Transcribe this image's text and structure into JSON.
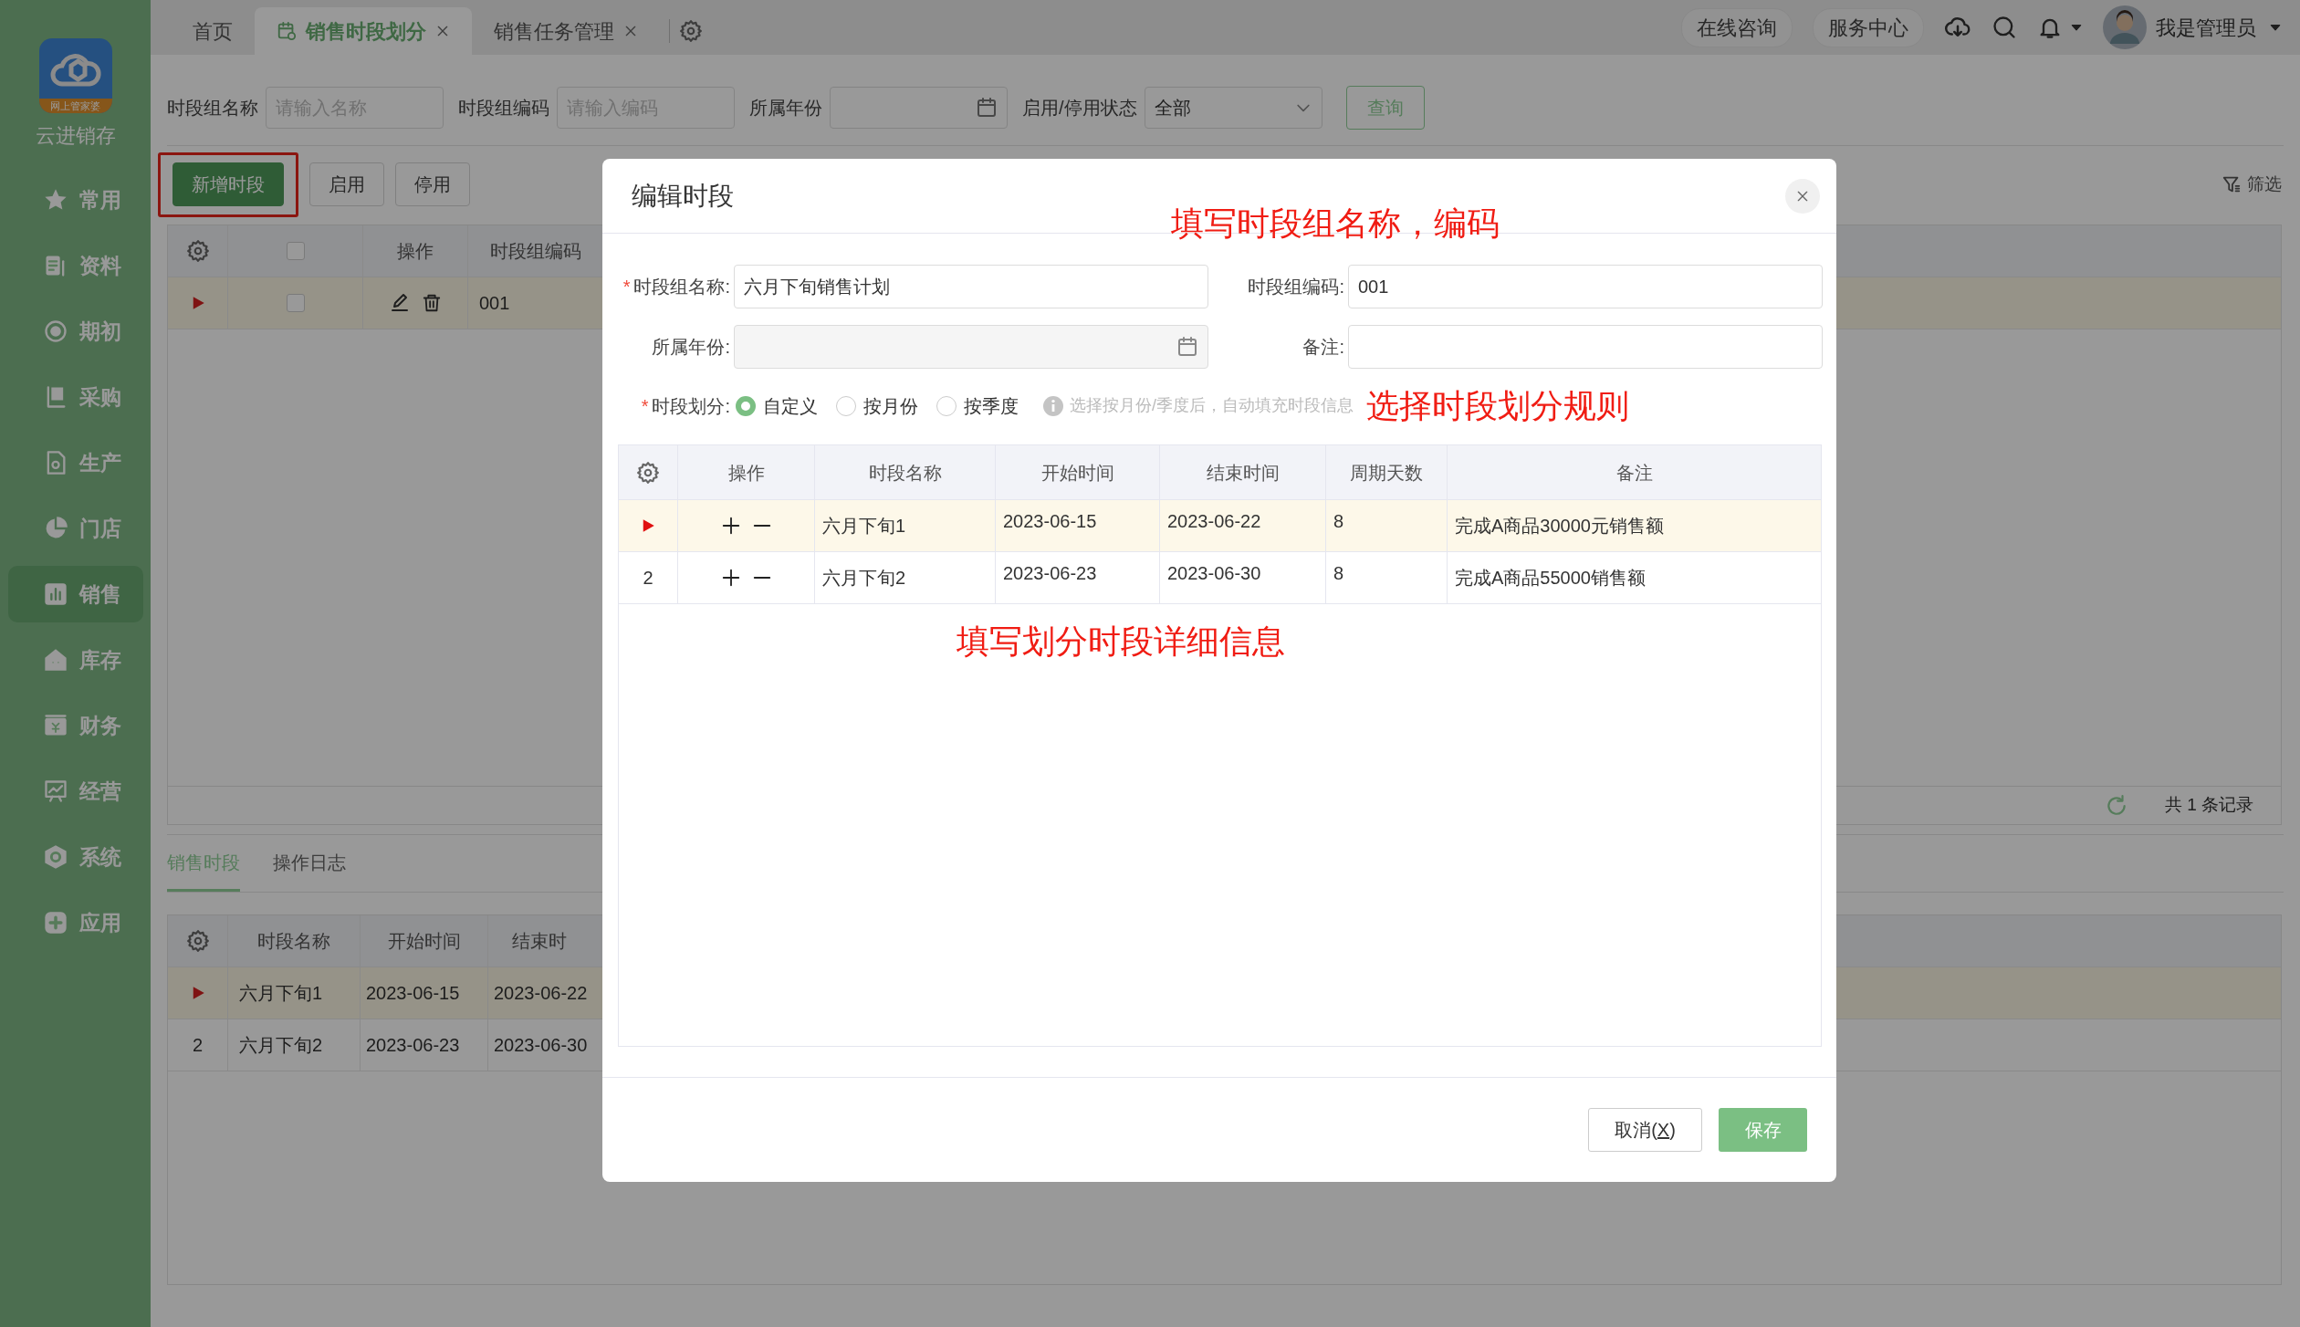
{
  "sidebar": {
    "logo_caption": "网上管家婆",
    "app_name": "云进销存",
    "items": [
      {
        "label": "常用",
        "selected": false
      },
      {
        "label": "资料",
        "selected": false
      },
      {
        "label": "期初",
        "selected": false
      },
      {
        "label": "采购",
        "selected": false
      },
      {
        "label": "生产",
        "selected": false
      },
      {
        "label": "门店",
        "selected": false
      },
      {
        "label": "销售",
        "selected": true
      },
      {
        "label": "库存",
        "selected": false
      },
      {
        "label": "财务",
        "selected": false
      },
      {
        "label": "经营",
        "selected": false
      },
      {
        "label": "系统",
        "selected": false
      },
      {
        "label": "应用",
        "selected": false
      }
    ]
  },
  "top_tabs": [
    {
      "label": "首页",
      "selected": false,
      "closable": false
    },
    {
      "label": "销售时段划分",
      "selected": true,
      "closable": true
    },
    {
      "label": "销售任务管理",
      "selected": false,
      "closable": true
    }
  ],
  "header_links": [
    "在线咨询",
    "服务中心"
  ],
  "user": {
    "name": "我是管理员"
  },
  "filters": [
    {
      "label": "时段组名称",
      "kind": "text",
      "placeholder": "请输入名称"
    },
    {
      "label": "时段组编码",
      "kind": "text",
      "placeholder": "请输入编码"
    },
    {
      "label": "所属年份",
      "kind": "date"
    },
    {
      "label": "启用/停用状态",
      "kind": "select",
      "value": "全部"
    }
  ],
  "query_button": "查询",
  "toolbar": {
    "buttons": [
      {
        "label": "新增时段",
        "primary": true,
        "highlighted": true
      },
      {
        "label": "启用",
        "primary": false,
        "highlighted": false
      },
      {
        "label": "停用",
        "primary": false,
        "highlighted": false
      }
    ],
    "filter_label": "筛选"
  },
  "group_table": {
    "select_all_checked": false,
    "columns": [
      "操作",
      "时段组编码"
    ],
    "rows": [
      {
        "selected": true,
        "checked": false,
        "code": "001"
      }
    ],
    "records_text": "共 1 条记录"
  },
  "bottom_tabs": [
    {
      "label": "销售时段",
      "selected": true
    },
    {
      "label": "操作日志",
      "selected": false
    }
  ],
  "period_table": {
    "columns": [
      "时段名称",
      "开始时间",
      "结束时"
    ],
    "rows": [
      {
        "selected": true,
        "name": "六月下旬1",
        "start": "2023-06-15",
        "end": "2023-06-22"
      },
      {
        "selected": false,
        "number": "2",
        "name": "六月下旬2",
        "start": "2023-06-23",
        "end": "2023-06-30"
      }
    ]
  },
  "modal": {
    "title": "编辑时段",
    "header_note": "填写时段组名称，编码",
    "fields": [
      {
        "label": "时段组名称:",
        "required_mark": "*",
        "kind": "text",
        "value": "六月下旬销售计划"
      },
      {
        "label": "时段组编码:",
        "kind": "text",
        "value": "001"
      },
      {
        "label": "所属年份:",
        "kind": "date",
        "disabled": true
      },
      {
        "label": "备注:",
        "kind": "text"
      }
    ],
    "division": {
      "label": "时段划分:",
      "required_mark": "*",
      "options": [
        {
          "label": "自定义",
          "selected": true
        },
        {
          "label": "按月份",
          "selected": false
        },
        {
          "label": "按季度",
          "selected": false
        }
      ],
      "hint": "选择按月份/季度后，自动填充时段信息",
      "note": "选择时段划分规则"
    },
    "detail_table": {
      "columns": [
        "操作",
        "时段名称",
        "开始时间",
        "结束时间",
        "周期天数",
        "备注"
      ],
      "rows": [
        {
          "selected": true,
          "name": "六月下旬1",
          "start": "2023-06-15",
          "end": "2023-06-22",
          "days": "8",
          "note": "完成A商品30000元销售额"
        },
        {
          "selected": false,
          "number": "2",
          "name": "六月下旬2",
          "start": "2023-06-23",
          "end": "2023-06-30",
          "days": "8",
          "note": "完成A商品55000销售额"
        }
      ],
      "note": "填写划分时段详细信息"
    },
    "cancel_button": {
      "label_before": "取消(",
      "access_key": "X",
      "label_after": ")"
    },
    "save_button": "保存"
  }
}
